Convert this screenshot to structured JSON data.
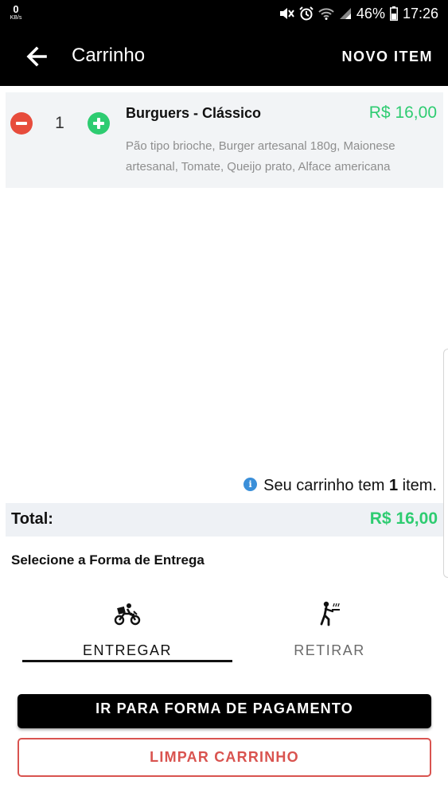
{
  "status_bar": {
    "net_speed": "0",
    "net_unit": "KB/s",
    "battery": "46%",
    "time": "17:26"
  },
  "app_bar": {
    "title": "Carrinho",
    "action": "NOVO ITEM"
  },
  "cart_item": {
    "quantity": "1",
    "name": "Burguers - Clássico",
    "price": "R$ 16,00",
    "description": "Pão tipo brioche, Burger artesanal 180g, Maionese artesanal, Tomate, Queijo prato, Alface americana"
  },
  "cart_info": {
    "prefix": "Seu carrinho tem ",
    "count": "1",
    "suffix": " item."
  },
  "total": {
    "label": "Total:",
    "value": "R$ 16,00"
  },
  "delivery": {
    "title": "Selecione a Forma de Entrega",
    "tabs": [
      {
        "label": "ENTREGAR",
        "icon": "motorcycle-delivery-icon",
        "selected": true
      },
      {
        "label": "RETIRAR",
        "icon": "waiter-pickup-icon",
        "selected": false
      }
    ]
  },
  "buttons": {
    "pay": "IR PARA FORMA DE PAGAMENTO",
    "clear": "LIMPAR CARRINHO"
  },
  "colors": {
    "accent_green": "#2ecc71",
    "danger_red": "#d9534f",
    "minus_red": "#e74c3c",
    "info_blue": "#3a8fd9",
    "bar_black": "#000000"
  }
}
